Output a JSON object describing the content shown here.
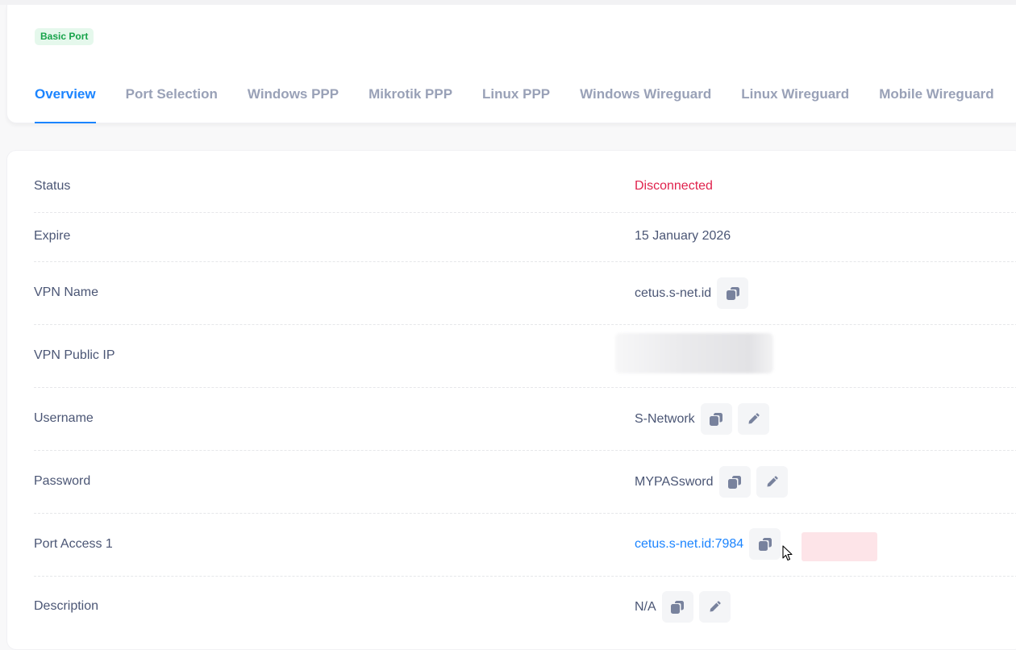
{
  "header": {
    "badge": "Basic Port",
    "tabs": [
      {
        "label": "Overview",
        "active": true
      },
      {
        "label": "Port Selection"
      },
      {
        "label": "Windows PPP"
      },
      {
        "label": "Mikrotik PPP"
      },
      {
        "label": "Linux PPP"
      },
      {
        "label": "Windows Wireguard"
      },
      {
        "label": "Linux Wireguard"
      },
      {
        "label": "Mobile Wireguard"
      }
    ]
  },
  "details": {
    "status": {
      "label": "Status",
      "value": "Disconnected"
    },
    "expire": {
      "label": "Expire",
      "value": "15 January 2026"
    },
    "vpn_name": {
      "label": "VPN Name",
      "value": "cetus.s-net.id"
    },
    "vpn_public_ip": {
      "label": "VPN Public IP"
    },
    "username": {
      "label": "Username",
      "value": "S-Network"
    },
    "password": {
      "label": "Password",
      "value": "MYPASsword"
    },
    "port_access_1": {
      "label": "Port Access 1",
      "value": "cetus.s-net.id:7984"
    },
    "description": {
      "label": "Description",
      "value": "N/A"
    }
  },
  "colors": {
    "accent": "#1b84ff",
    "danger": "#e0234d",
    "success": "#17a34a",
    "muted": "#99a1b7"
  },
  "icons": {
    "copy": "copy-icon",
    "edit": "pencil-icon",
    "cursor": "mouse-pointer-icon"
  }
}
